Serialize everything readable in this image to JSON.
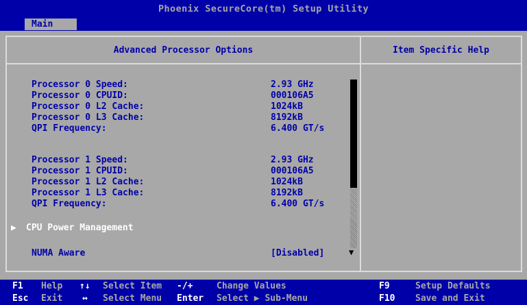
{
  "title": "Phoenix SecureCore(tm) Setup Utility",
  "menu": {
    "active_tab": "Main"
  },
  "panel": {
    "title": "Advanced Processor Options",
    "help_title": "Item Specific Help"
  },
  "processor0": [
    {
      "label": "Processor 0 Speed:",
      "value": "2.93 GHz"
    },
    {
      "label": "Processor 0 CPUID:",
      "value": "000106A5"
    },
    {
      "label": "Processor 0 L2 Cache:",
      "value": "1024kB"
    },
    {
      "label": "Processor 0 L3 Cache:",
      "value": "8192kB"
    },
    {
      "label": "QPI Frequency:",
      "value": "6.400 GT/s"
    }
  ],
  "processor1": [
    {
      "label": "Processor 1 Speed:",
      "value": "2.93 GHz"
    },
    {
      "label": "Processor 1 CPUID:",
      "value": "000106A5"
    },
    {
      "label": "Processor 1 L2 Cache:",
      "value": "1024kB"
    },
    {
      "label": "Processor 1 L3 Cache:",
      "value": "8192kB"
    },
    {
      "label": "QPI Frequency:",
      "value": "6.400 GT/s"
    }
  ],
  "submenu": {
    "arrow": "▶",
    "label": "CPU Power Management"
  },
  "numa": {
    "label": "NUMA Aware",
    "value": "[Disabled]"
  },
  "scroll_arrow": "▼",
  "status": {
    "f1_key": "F1",
    "f1_desc": "Help",
    "updown_key": "↑↓",
    "updown_desc": "Select Item",
    "pm_key": "-/+",
    "pm_desc": "Change Values",
    "f9_key": "F9",
    "f9_desc": "Setup Defaults",
    "esc_key": "Esc",
    "esc_desc": "Exit",
    "lr_key": "↔",
    "lr_desc": "Select Menu",
    "enter_key": "Enter",
    "enter_desc": "Select ▶ Sub-Menu",
    "f10_key": "F10",
    "f10_desc": "Save and Exit"
  }
}
